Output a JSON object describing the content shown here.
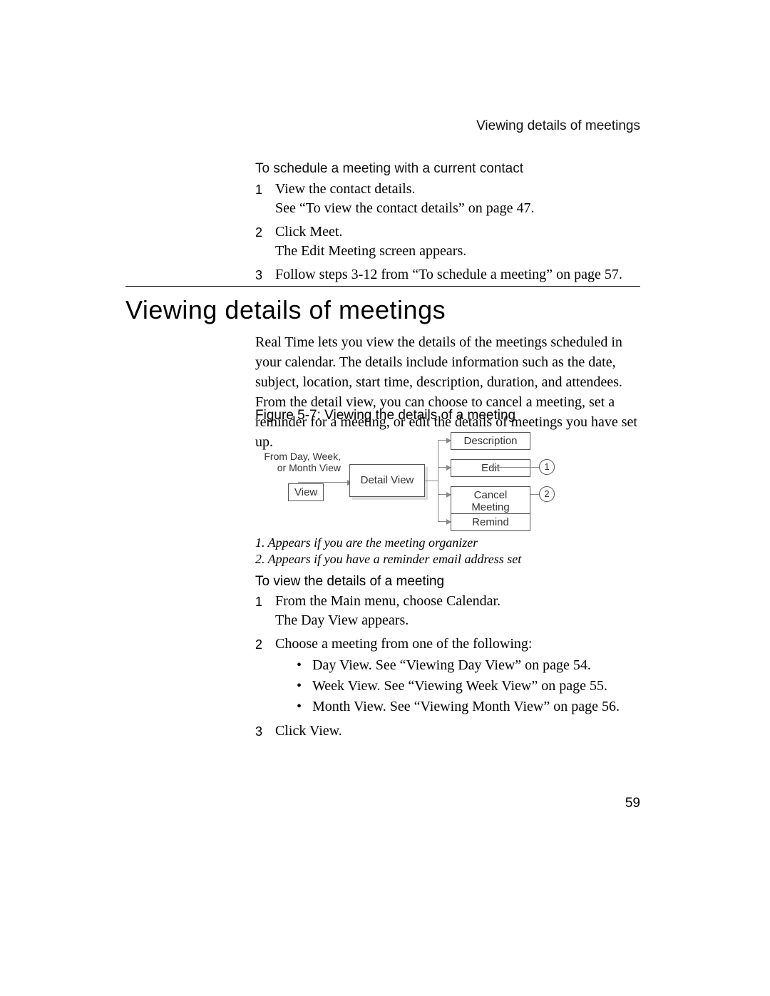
{
  "running_head": "Viewing details of meetings",
  "proc1": {
    "title": "To schedule a meeting with a current contact",
    "steps": [
      {
        "n": "1",
        "lines": [
          "View the contact details.",
          "See “To view the contact details” on page 47."
        ]
      },
      {
        "n": "2",
        "lines": [
          "Click Meet.",
          "The Edit Meeting screen appears."
        ]
      },
      {
        "n": "3",
        "lines": [
          "Follow steps 3-12 from “To schedule a meeting” on page 57."
        ]
      }
    ]
  },
  "section": {
    "title": "Viewing details of meetings",
    "para": "Real Time lets you view the details of the meetings scheduled in your calendar. The details include information such as the date, subject, location, start time, description, duration, and attendees. From the detail view, you can choose to cancel a meeting, set a reminder for a meeting, or edit the details of meetings you have set up."
  },
  "figure": {
    "caption": "Figure 5-7: Viewing the details of a meeting",
    "from_label_line1": "From Day, Week,",
    "from_label_line2": "or Month View",
    "view_btn": "View",
    "detail_box": "Detail View",
    "buttons": {
      "description": "Description",
      "edit": "Edit",
      "cancel": "Cancel Meeting",
      "remind": "Remind"
    },
    "callouts": {
      "c1": "1",
      "c2": "2"
    }
  },
  "footnotes": [
    "1. Appears if you are the meeting organizer",
    "2. Appears if you have a reminder email address set"
  ],
  "proc2": {
    "title": "To view the details of a meeting",
    "steps": [
      {
        "n": "1",
        "lines": [
          "From the Main menu, choose Calendar.",
          "The Day View appears."
        ]
      },
      {
        "n": "2",
        "lines": [
          "Choose a meeting from one of the following:"
        ],
        "bullets": [
          "Day View. See “Viewing Day View” on page 54.",
          "Week View. See “Viewing Week View” on page 55.",
          "Month View. See “Viewing Month View” on page 56."
        ]
      },
      {
        "n": "3",
        "lines": [
          "Click View."
        ]
      }
    ]
  },
  "page_number": "59"
}
